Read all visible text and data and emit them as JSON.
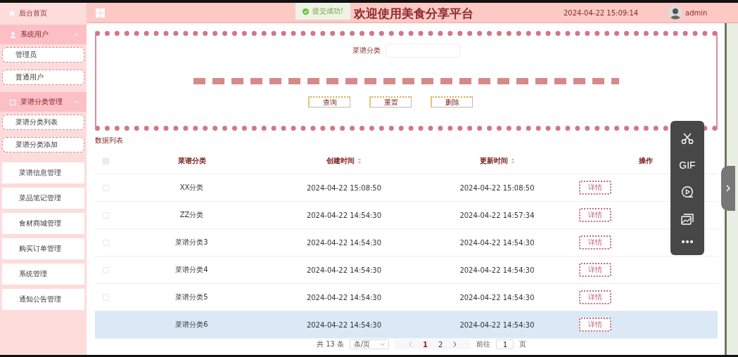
{
  "header": {
    "home": "后台首页",
    "title": "欢迎使用美食分享平台",
    "datetime": "2024-04-22 15:09:14",
    "user": "admin"
  },
  "toast": {
    "message": "提交成功!"
  },
  "sidebar": {
    "groups": [
      {
        "label": "系统用户",
        "expanded": true,
        "children": [
          {
            "label": "管理员"
          },
          {
            "label": "普通用户"
          }
        ]
      },
      {
        "label": "菜谱分类管理",
        "expanded": true,
        "children": [
          {
            "label": "菜谱分类列表"
          },
          {
            "label": "菜谱分类添加"
          }
        ]
      }
    ],
    "items": [
      {
        "label": "菜谱信息管理"
      },
      {
        "label": "菜品笔记管理"
      },
      {
        "label": "食材商城管理"
      },
      {
        "label": "购买订单管理"
      },
      {
        "label": "系统管理"
      },
      {
        "label": "通知公告管理"
      }
    ]
  },
  "search": {
    "label": "菜谱分类",
    "buttons": [
      "查询",
      "重置",
      "删除"
    ]
  },
  "table": {
    "title": "数据列表",
    "all_checked": false,
    "columns": [
      {
        "label": "菜谱分类",
        "sortable": false
      },
      {
        "label": "创建时间",
        "sortable": true
      },
      {
        "label": "更新时间",
        "sortable": true
      },
      {
        "label": "操作",
        "sortable": false
      }
    ],
    "rows": [
      {
        "cells": [
          "XX分类",
          "2024-04-22 15:08:50",
          "2024-04-22 15:08:50"
        ],
        "action": "详情",
        "checked": false,
        "highlighted": false
      },
      {
        "cells": [
          "ZZ分类",
          "2024-04-22 14:54:30",
          "2024-04-22 14:57:34"
        ],
        "action": "详情",
        "checked": false,
        "highlighted": false
      },
      {
        "cells": [
          "菜谱分类3",
          "2024-04-22 14:54:30",
          "2024-04-22 14:54:30"
        ],
        "action": "详情",
        "checked": false,
        "highlighted": false
      },
      {
        "cells": [
          "菜谱分类4",
          "2024-04-22 14:54:30",
          "2024-04-22 14:54:30"
        ],
        "action": "详情",
        "checked": false,
        "highlighted": false
      },
      {
        "cells": [
          "菜谱分类5",
          "2024-04-22 14:54:30",
          "2024-04-22 14:54:30"
        ],
        "action": "详情",
        "checked": false,
        "highlighted": false
      },
      {
        "cells": [
          "菜谱分类6",
          "2024-04-22 14:54:30",
          "2024-04-22 14:54:30"
        ],
        "action": "详情",
        "checked": false,
        "highlighted": true
      }
    ]
  },
  "pagination": {
    "total": "共 13 条",
    "page_size": "条/页",
    "pages": [
      {
        "label": "1",
        "selected": true
      },
      {
        "label": "2",
        "selected": false
      }
    ],
    "goto_label": "前往",
    "goto_value": "1",
    "goto_suffix": "页"
  },
  "floating_toolbar": {
    "tools": [
      {
        "kind": "scissors"
      },
      {
        "kind": "gif",
        "label": "GIF"
      },
      {
        "kind": "record"
      },
      {
        "kind": "image"
      },
      {
        "kind": "more"
      }
    ]
  }
}
